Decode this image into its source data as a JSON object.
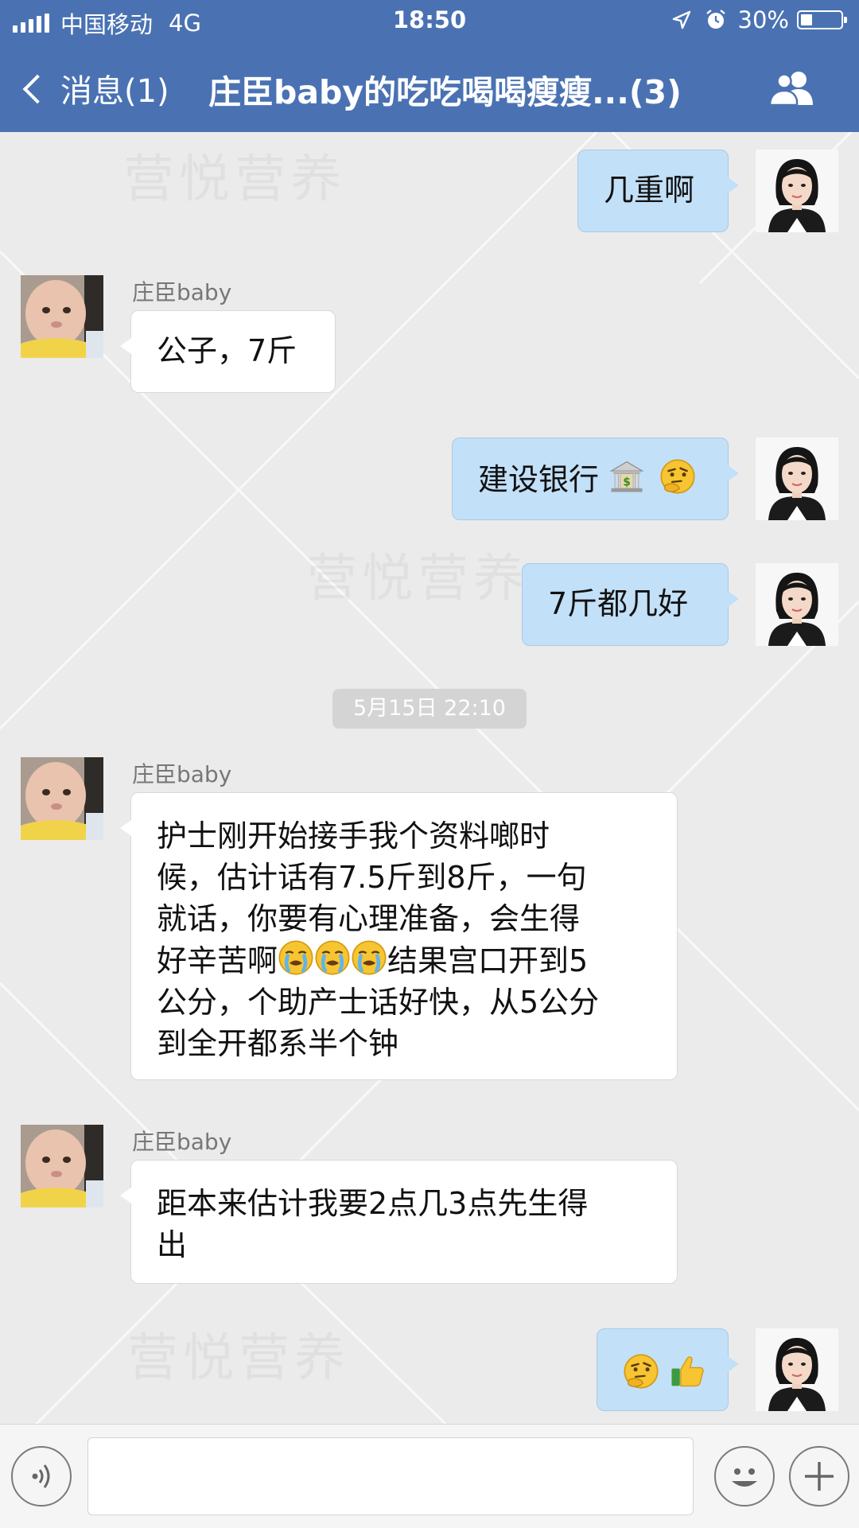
{
  "status_bar": {
    "carrier": "中国移动",
    "network": "4G",
    "time": "18:50",
    "battery": "30%",
    "battery_level": 0.3
  },
  "header": {
    "back_label": "消息(1)",
    "title": "庄臣baby的吃吃喝喝瘦瘦...(3)",
    "background_color": "#4a72b3",
    "right_icon": "group-members-icon"
  },
  "watermark": "营悦营养",
  "messages": [
    {
      "side": "me",
      "text": "几重啊"
    },
    {
      "side": "other",
      "sender": "庄臣baby",
      "text": "公子，7斤"
    },
    {
      "side": "me",
      "text": "建设银行",
      "emoji": [
        "bank-emoji",
        "thinking-face-emoji"
      ]
    },
    {
      "side": "me",
      "text": "7斤都几好"
    },
    {
      "side": "other",
      "sender": "庄臣baby",
      "lines": [
        "护士刚开始接手我个资料啷时",
        "候，估计话有7.5斤到8斤，一句",
        "就话，你要有心理准备，会生得",
        "好辛苦啊",
        "结果宫口开到5",
        "公分，个助产士话好快，从5公分",
        "到全开都系半个钟"
      ],
      "emoji": [
        "crying-face-emoji",
        "crying-face-emoji",
        "crying-face-emoji"
      ]
    },
    {
      "side": "other",
      "sender": "庄臣baby",
      "lines": [
        "距本来估计我要2点几3点先生得",
        "出"
      ]
    },
    {
      "side": "me",
      "text": "",
      "emoji": [
        "thinking-face-emoji",
        "thumbs-up-emoji"
      ]
    }
  ],
  "timestamp": "5月15日 22:10",
  "input_bar": {
    "left_icon": "voice-icon",
    "emoji_icon": "emoji-face-icon",
    "plus_icon": "plus-icon",
    "placeholder": ""
  }
}
